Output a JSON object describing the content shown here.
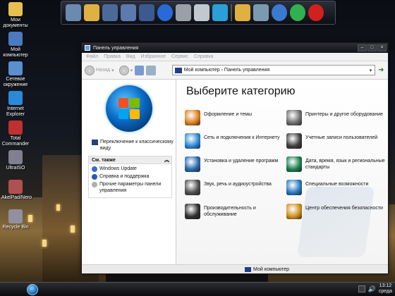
{
  "desktop": {
    "icons": [
      {
        "label": "Мои документы",
        "icon": "documents-icon",
        "color": "#e8c050"
      },
      {
        "label": "Мой компьютер",
        "icon": "computer-icon",
        "color": "#4a7ac0"
      },
      {
        "label": "Сетевое окружение",
        "icon": "network-icon",
        "color": "#5a8fd0"
      },
      {
        "label": "Internet Explorer",
        "icon": "internet-explorer-icon",
        "color": "#2a8ad8"
      },
      {
        "label": "Total Commander",
        "icon": "total-commander-icon",
        "color": "#c03030"
      },
      {
        "label": "UltraISO",
        "icon": "ultraiso-icon",
        "color": "#808090"
      },
      {
        "label": "AkelPad/Nero",
        "icon": "app-icon",
        "color": "#b05050"
      },
      {
        "label": "Recycle Bin",
        "icon": "recycle-bin-icon",
        "color": "#9090a0"
      }
    ]
  },
  "dock": {
    "items": [
      {
        "icon": "monitor-icon",
        "color": "#6a8ab0"
      },
      {
        "icon": "folder-icon",
        "color": "#e0b040"
      },
      {
        "icon": "folder-icon",
        "color": "#4a6a9a"
      },
      {
        "icon": "documents-icon",
        "color": "#5a7ab0"
      },
      {
        "icon": "music-folder-icon",
        "color": "#3a5a90"
      },
      {
        "icon": "media-player-icon",
        "color": "#2a6ad8"
      },
      {
        "icon": "calculator-icon",
        "color": "#9aa0a8"
      },
      {
        "icon": "disk-icon",
        "color": "#c0c8d0"
      },
      {
        "icon": "internet-explorer-icon",
        "color": "#2aa0d8"
      },
      {
        "icon": "tools-icon",
        "color": "#e0b040"
      },
      {
        "icon": "recycle-bin-icon",
        "color": "#7a9ab0"
      },
      {
        "icon": "search-icon",
        "color": "#3a7ad0"
      },
      {
        "icon": "settings-icon",
        "color": "#30b050"
      },
      {
        "icon": "power-icon",
        "color": "#d02020"
      }
    ]
  },
  "window": {
    "title": "Панель управления",
    "menu": [
      "Файл",
      "Правка",
      "Вид",
      "Избранное",
      "Сервис",
      "Справка"
    ],
    "toolbar": {
      "back_label": "Назад"
    },
    "address": {
      "path": "Мой компьютер › Панель управления"
    },
    "left": {
      "switch_view": "Переключение к классическому виду",
      "see_also_title": "См. также",
      "see_also": [
        {
          "label": "Windows Update",
          "color": "#3a6ad0"
        },
        {
          "label": "Справка и поддержка",
          "color": "#2a5ab0"
        },
        {
          "label": "Прочие параметры панели управления",
          "color": "#b0b0b0"
        }
      ]
    },
    "main": {
      "heading": "Выберите категорию",
      "categories": [
        {
          "label": "Оформление и темы",
          "icon": "appearance-icon",
          "color": "#e08020"
        },
        {
          "label": "Принтеры и другое оборудование",
          "icon": "printer-icon",
          "color": "#707070"
        },
        {
          "label": "Сеть и подключения к Интернету",
          "icon": "network-icon",
          "color": "#2a8ad8"
        },
        {
          "label": "Учетные записи пользователей",
          "icon": "users-icon",
          "color": "#404040"
        },
        {
          "label": "Установка и удаление программ",
          "icon": "programs-icon",
          "color": "#2a6ab0"
        },
        {
          "label": "Дата, время, язык и региональные стандарты",
          "icon": "date-time-icon",
          "color": "#208050"
        },
        {
          "label": "Звук, речь и аудиоустройства",
          "icon": "sound-icon",
          "color": "#505050"
        },
        {
          "label": "Специальные возможности",
          "icon": "accessibility-icon",
          "color": "#2a7ac0"
        },
        {
          "label": "Производительность и обслуживание",
          "icon": "performance-icon",
          "color": "#303030"
        },
        {
          "label": "Центр обеспечения безопасности",
          "icon": "security-shield-icon",
          "color": "#d09020"
        }
      ]
    },
    "status": "Мой компьютер"
  },
  "taskbar": {
    "time": "13:12",
    "day": "среда"
  }
}
